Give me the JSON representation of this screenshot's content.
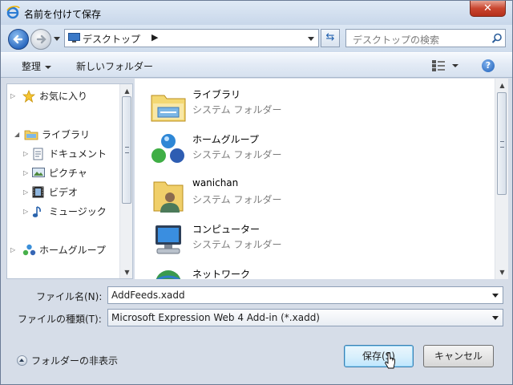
{
  "window": {
    "title": "名前を付けて保存",
    "close_label": "✕"
  },
  "address": {
    "location": "デスクトップ",
    "chevron": "▶"
  },
  "search": {
    "placeholder": "デスクトップの検索"
  },
  "toolbar": {
    "organize_label": "整理",
    "new_folder_label": "新しいフォルダー",
    "help_label": "?"
  },
  "nav_pane": {
    "items": [
      {
        "label": "お気に入り",
        "icon": "star-icon"
      },
      {
        "label": "ライブラリ",
        "icon": "library-icon"
      },
      {
        "label": "ドキュメント",
        "icon": "documents-icon"
      },
      {
        "label": "ピクチャ",
        "icon": "pictures-icon"
      },
      {
        "label": "ビデオ",
        "icon": "videos-icon"
      },
      {
        "label": "ミュージック",
        "icon": "music-icon"
      },
      {
        "label": "ホームグループ",
        "icon": "homegroup-icon"
      }
    ]
  },
  "file_list": {
    "items": [
      {
        "name": "ライブラリ",
        "type": "システム フォルダー",
        "icon": "library-folder-icon"
      },
      {
        "name": "ホームグループ",
        "type": "システム フォルダー",
        "icon": "homegroup-icon"
      },
      {
        "name": "wanichan",
        "type": "システム フォルダー",
        "icon": "user-folder-icon"
      },
      {
        "name": "コンピューター",
        "type": "システム フォルダー",
        "icon": "computer-icon"
      },
      {
        "name": "ネットワーク",
        "type": "",
        "icon": "network-icon"
      }
    ]
  },
  "form": {
    "filename_label": "ファイル名(N):",
    "filename_value": "AddFeeds.xadd",
    "filetype_label": "ファイルの種類(T):",
    "filetype_value": "Microsoft Expression Web 4 Add-in (*.xadd)"
  },
  "footer": {
    "hide_folders_label": "フォルダーの非表示",
    "save_label": "保存(S)",
    "cancel_label": "キャンセル"
  },
  "colors": {
    "accent": "#2d6bc1",
    "close": "#c9452e",
    "frame": "#d6dde8"
  }
}
